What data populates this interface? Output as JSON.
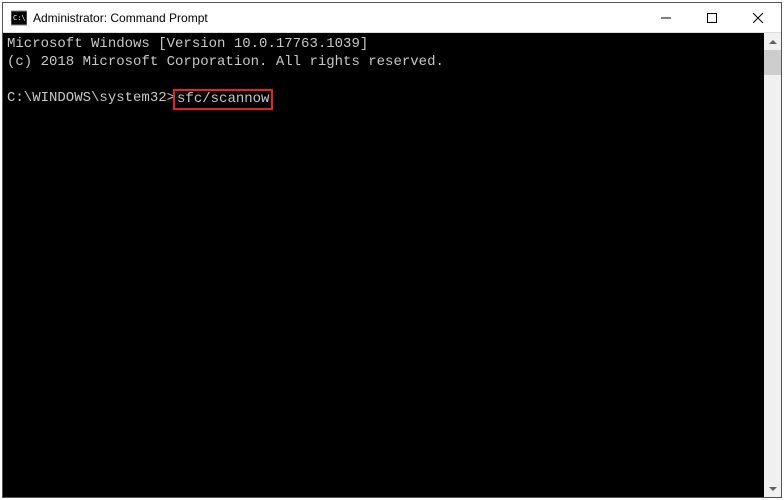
{
  "titlebar": {
    "title": "Administrator: Command Prompt"
  },
  "terminal": {
    "line1": "Microsoft Windows [Version 10.0.17763.1039]",
    "line2": "(c) 2018 Microsoft Corporation. All rights reserved.",
    "prompt": "C:\\WINDOWS\\system32>",
    "command": "sfc/scannow"
  },
  "highlight": {
    "border_color": "#e62222"
  }
}
